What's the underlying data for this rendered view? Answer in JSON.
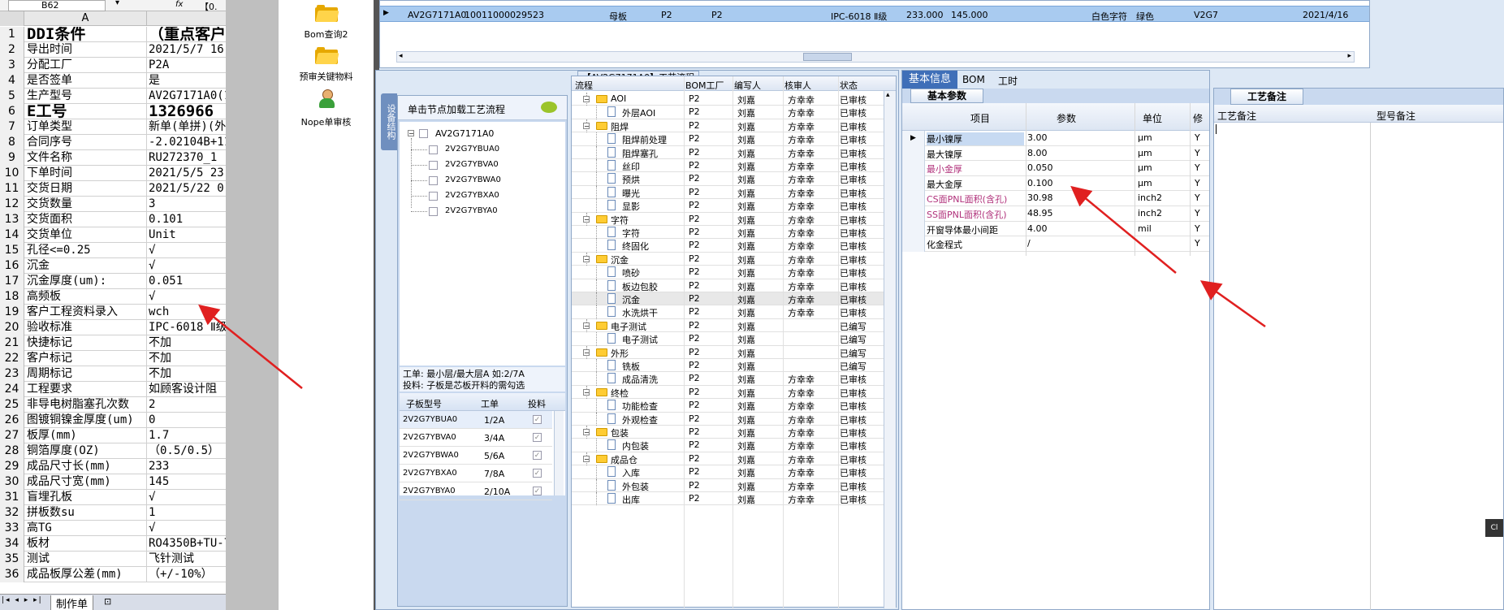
{
  "excel": {
    "cell_ref": "B62",
    "fx": "fx",
    "formula_partial": "【0.",
    "col_a": "A",
    "sheet_tab": "制作单",
    "rows": [
      {
        "n": "1",
        "a": "DDI条件",
        "b": "（重点客户"
      },
      {
        "n": "2",
        "a": "导出时间",
        "b": "2021/5/7 16:"
      },
      {
        "n": "3",
        "a": "分配工厂",
        "b": "P2A"
      },
      {
        "n": "4",
        "a": "是否签单",
        "b": "是"
      },
      {
        "n": "5",
        "a": "生产型号",
        "b": "AV2G7171A0(1"
      },
      {
        "n": "6",
        "a": "E工号",
        "b": "1326966"
      },
      {
        "n": "7",
        "a": "订单类型",
        "b": "新单(单拼)(外"
      },
      {
        "n": "8",
        "a": "合同序号",
        "b": "-2.02104B+11"
      },
      {
        "n": "9",
        "a": "文件名称",
        "b": "RU272370_1"
      },
      {
        "n": "10",
        "a": "下单时间",
        "b": "2021/5/5 23:"
      },
      {
        "n": "11",
        "a": "交货日期",
        "b": "2021/5/22 0:"
      },
      {
        "n": "12",
        "a": "交货数量",
        "b": "3"
      },
      {
        "n": "13",
        "a": "交货面积",
        "b": "0.101"
      },
      {
        "n": "14",
        "a": "交货单位",
        "b": "Unit"
      },
      {
        "n": "15",
        "a": "孔径<=0.25",
        "b": "√"
      },
      {
        "n": "16",
        "a": "沉金",
        "b": "√"
      },
      {
        "n": "17",
        "a": "沉金厚度(um):",
        "b": "0.051"
      },
      {
        "n": "18",
        "a": "高频板",
        "b": "√"
      },
      {
        "n": "19",
        "a": "客户工程资料录入",
        "b": "wch"
      },
      {
        "n": "20",
        "a": "验收标准",
        "b": "IPC-6018 Ⅱ级"
      },
      {
        "n": "21",
        "a": "快捷标记",
        "b": "不加"
      },
      {
        "n": "22",
        "a": "客户标记",
        "b": "不加"
      },
      {
        "n": "23",
        "a": "周期标记",
        "b": "不加"
      },
      {
        "n": "24",
        "a": "工程要求",
        "b": "如顾客设计阻"
      },
      {
        "n": "25",
        "a": "非导电树脂塞孔次数",
        "b": "2"
      },
      {
        "n": "26",
        "a": "图镀铜镍金厚度(um)",
        "b": "0"
      },
      {
        "n": "27",
        "a": "板厚(mm)",
        "b": "1.7"
      },
      {
        "n": "28",
        "a": "铜箔厚度(OZ)",
        "b": "（0.5/0.5）"
      },
      {
        "n": "29",
        "a": "成品尺寸长(mm)",
        "b": "233"
      },
      {
        "n": "30",
        "a": "成品尺寸宽(mm)",
        "b": "145"
      },
      {
        "n": "31",
        "a": "盲埋孔板",
        "b": "√"
      },
      {
        "n": "32",
        "a": "拼板数su",
        "b": "1"
      },
      {
        "n": "33",
        "a": "高TG",
        "b": "√"
      },
      {
        "n": "34",
        "a": "板材",
        "b": "RO4350B+TU-7"
      },
      {
        "n": "35",
        "a": "测试",
        "b": "飞针测试"
      },
      {
        "n": "36",
        "a": "成品板厚公差(mm)",
        "b": "（+/-10%）"
      }
    ]
  },
  "icons": [
    {
      "label": "Bom查询2",
      "kind": "folder"
    },
    {
      "label": "预审关键物料",
      "kind": "folder"
    },
    {
      "label": "Nope单审核",
      "kind": "user"
    }
  ],
  "top_row": {
    "cells": [
      "AV2G7171A0",
      "10011000029523",
      "母板",
      "P2",
      "P2",
      "IPC-6018 Ⅱ级",
      "233.000",
      "145.000",
      "白色字符",
      "绿色",
      "V2G7",
      "2021/4/16"
    ]
  },
  "process_panel": {
    "title": "【AV2G7171A0】工艺流程",
    "side_tab": "设备结构",
    "hint": "单击节点加载工艺流程",
    "tree_root": "AV2G7171A0",
    "tree_children": [
      "2V2G7YBUA0",
      "2V2G7YBVA0",
      "2V2G7YBWA0",
      "2V2G7YBXA0",
      "2V2G7YBYA0"
    ],
    "note1": "工单: 最小层/最大层A 如:2/7A",
    "note2": "投料: 子板是芯板开料的需勾选",
    "sub_headers": [
      "子板型号",
      "工单",
      "投料"
    ],
    "sub_rows": [
      {
        "m": "2V2G7YBUA0",
        "w": "1/2A",
        "checked": true
      },
      {
        "m": "2V2G7YBVA0",
        "w": "3/4A",
        "checked": true
      },
      {
        "m": "2V2G7YBWA0",
        "w": "5/6A",
        "checked": true
      },
      {
        "m": "2V2G7YBXA0",
        "w": "7/8A",
        "checked": true
      },
      {
        "m": "2V2G7YBYA0",
        "w": "2/10A",
        "checked": true
      }
    ],
    "flow_headers": [
      "流程",
      "BOM工厂",
      "编写人",
      "核审人",
      "状态"
    ],
    "flow_rows": [
      {
        "lvl": 0,
        "name": "AOI",
        "f": "P2",
        "w": "刘嘉",
        "r": "方幸幸",
        "s": "已审核"
      },
      {
        "lvl": 1,
        "name": "外层AOI",
        "f": "P2",
        "w": "刘嘉",
        "r": "方幸幸",
        "s": "已审核"
      },
      {
        "lvl": 0,
        "name": "阻焊",
        "f": "P2",
        "w": "刘嘉",
        "r": "方幸幸",
        "s": "已审核"
      },
      {
        "lvl": 1,
        "name": "阻焊前处理",
        "f": "P2",
        "w": "刘嘉",
        "r": "方幸幸",
        "s": "已审核"
      },
      {
        "lvl": 1,
        "name": "阻焊塞孔",
        "f": "P2",
        "w": "刘嘉",
        "r": "方幸幸",
        "s": "已审核"
      },
      {
        "lvl": 1,
        "name": "丝印",
        "f": "P2",
        "w": "刘嘉",
        "r": "方幸幸",
        "s": "已审核"
      },
      {
        "lvl": 1,
        "name": "预烘",
        "f": "P2",
        "w": "刘嘉",
        "r": "方幸幸",
        "s": "已审核"
      },
      {
        "lvl": 1,
        "name": "曝光",
        "f": "P2",
        "w": "刘嘉",
        "r": "方幸幸",
        "s": "已审核"
      },
      {
        "lvl": 1,
        "name": "显影",
        "f": "P2",
        "w": "刘嘉",
        "r": "方幸幸",
        "s": "已审核"
      },
      {
        "lvl": 0,
        "name": "字符",
        "f": "P2",
        "w": "刘嘉",
        "r": "方幸幸",
        "s": "已审核"
      },
      {
        "lvl": 1,
        "name": "字符",
        "f": "P2",
        "w": "刘嘉",
        "r": "方幸幸",
        "s": "已审核"
      },
      {
        "lvl": 1,
        "name": "终固化",
        "f": "P2",
        "w": "刘嘉",
        "r": "方幸幸",
        "s": "已审核"
      },
      {
        "lvl": 0,
        "name": "沉金",
        "f": "P2",
        "w": "刘嘉",
        "r": "方幸幸",
        "s": "已审核"
      },
      {
        "lvl": 1,
        "name": "喷砂",
        "f": "P2",
        "w": "刘嘉",
        "r": "方幸幸",
        "s": "已审核"
      },
      {
        "lvl": 1,
        "name": "板边包胶",
        "f": "P2",
        "w": "刘嘉",
        "r": "方幸幸",
        "s": "已审核"
      },
      {
        "lvl": 1,
        "name": "沉金",
        "f": "P2",
        "w": "刘嘉",
        "r": "方幸幸",
        "s": "已审核"
      },
      {
        "lvl": 1,
        "name": "水洗烘干",
        "f": "P2",
        "w": "刘嘉",
        "r": "方幸幸",
        "s": "已审核"
      },
      {
        "lvl": 0,
        "name": "电子测试",
        "f": "P2",
        "w": "刘嘉",
        "r": "",
        "s": "已编写"
      },
      {
        "lvl": 1,
        "name": "电子测试",
        "f": "P2",
        "w": "刘嘉",
        "r": "",
        "s": "已编写"
      },
      {
        "lvl": 0,
        "name": "外形",
        "f": "P2",
        "w": "刘嘉",
        "r": "",
        "s": "已编写"
      },
      {
        "lvl": 1,
        "name": "铣板",
        "f": "P2",
        "w": "刘嘉",
        "r": "",
        "s": "已编写"
      },
      {
        "lvl": 1,
        "name": "成品清洗",
        "f": "P2",
        "w": "刘嘉",
        "r": "方幸幸",
        "s": "已审核"
      },
      {
        "lvl": 0,
        "name": "终检",
        "f": "P2",
        "w": "刘嘉",
        "r": "方幸幸",
        "s": "已审核"
      },
      {
        "lvl": 1,
        "name": "功能检查",
        "f": "P2",
        "w": "刘嘉",
        "r": "方幸幸",
        "s": "已审核"
      },
      {
        "lvl": 1,
        "name": "外观检查",
        "f": "P2",
        "w": "刘嘉",
        "r": "方幸幸",
        "s": "已审核"
      },
      {
        "lvl": 0,
        "name": "包装",
        "f": "P2",
        "w": "刘嘉",
        "r": "方幸幸",
        "s": "已审核"
      },
      {
        "lvl": 1,
        "name": "内包装",
        "f": "P2",
        "w": "刘嘉",
        "r": "方幸幸",
        "s": "已审核"
      },
      {
        "lvl": 0,
        "name": "成品仓",
        "f": "P2",
        "w": "刘嘉",
        "r": "方幸幸",
        "s": "已审核"
      },
      {
        "lvl": 1,
        "name": "入库",
        "f": "P2",
        "w": "刘嘉",
        "r": "方幸幸",
        "s": "已审核"
      },
      {
        "lvl": 1,
        "name": "外包装",
        "f": "P2",
        "w": "刘嘉",
        "r": "方幸幸",
        "s": "已审核"
      },
      {
        "lvl": 1,
        "name": "出库",
        "f": "P2",
        "w": "刘嘉",
        "r": "方幸幸",
        "s": "已审核"
      }
    ]
  },
  "info_panel": {
    "tabs": [
      "基本信息",
      "BOM",
      "工时"
    ],
    "subtab": "基本参数",
    "headers": [
      "项目",
      "参数",
      "单位",
      "修"
    ],
    "rows": [
      {
        "item": "最小镍厚",
        "param": "3.00",
        "unit": "μm",
        "m": "Y",
        "pink": false
      },
      {
        "item": "最大镍厚",
        "param": "8.00",
        "unit": "μm",
        "m": "Y",
        "pink": false
      },
      {
        "item": "最小金厚",
        "param": "0.050",
        "unit": "μm",
        "m": "Y",
        "pink": true
      },
      {
        "item": "最大金厚",
        "param": "0.100",
        "unit": "μm",
        "m": "Y",
        "pink": false
      },
      {
        "item": "CS面PNL面积(含孔)",
        "param": "30.98",
        "unit": "inch2",
        "m": "Y",
        "pink": true
      },
      {
        "item": "SS面PNL面积(含孔)",
        "param": "48.95",
        "unit": "inch2",
        "m": "Y",
        "pink": true
      },
      {
        "item": "开窗导体最小间距",
        "param": "4.00",
        "unit": "mil",
        "m": "Y",
        "pink": false
      },
      {
        "item": "化金程式",
        "param": "/",
        "unit": "",
        "m": "Y",
        "pink": false
      }
    ]
  },
  "remark_panel": {
    "tab": "工艺备注",
    "headers": [
      "工艺备注",
      "型号备注"
    ]
  },
  "edge_button": "Cl"
}
